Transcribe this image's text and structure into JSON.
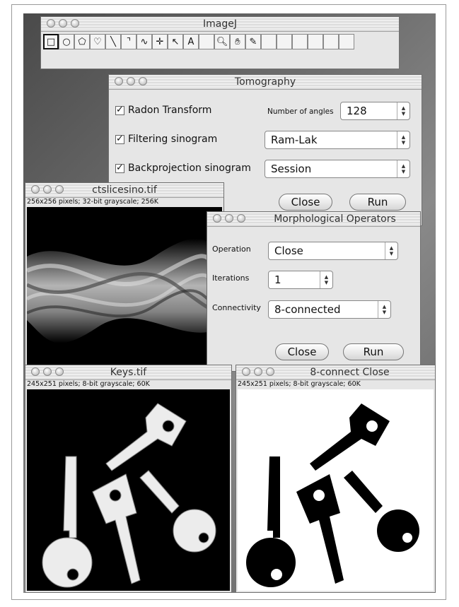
{
  "imagej": {
    "title": "ImageJ",
    "tools": [
      {
        "icon": "rectangle-tool-icon",
        "glyph": "□"
      },
      {
        "icon": "oval-tool-icon",
        "glyph": "○"
      },
      {
        "icon": "polygon-tool-icon",
        "glyph": "⬠"
      },
      {
        "icon": "freehand-tool-icon",
        "glyph": "♡"
      },
      {
        "icon": "straight-line-tool-icon",
        "glyph": "╲"
      },
      {
        "icon": "segmented-line-tool-icon",
        "glyph": "⌝"
      },
      {
        "icon": "freehand-line-tool-icon",
        "glyph": "∿"
      },
      {
        "icon": "crosshair-tool-icon",
        "glyph": "✛"
      },
      {
        "icon": "wand-tool-icon",
        "glyph": "↖"
      },
      {
        "icon": "text-tool-icon",
        "glyph": "A"
      },
      {
        "icon": "blank-tool-icon",
        "glyph": ""
      },
      {
        "icon": "magnifier-tool-icon",
        "glyph": "🔍︎"
      },
      {
        "icon": "hand-tool-icon",
        "glyph": "✋︎"
      },
      {
        "icon": "dropper-tool-icon",
        "glyph": "✎"
      },
      {
        "icon": "blank-tool-icon",
        "glyph": ""
      },
      {
        "icon": "blank-tool-icon",
        "glyph": ""
      },
      {
        "icon": "blank-tool-icon",
        "glyph": ""
      },
      {
        "icon": "blank-tool-icon",
        "glyph": ""
      },
      {
        "icon": "blank-tool-icon",
        "glyph": ""
      },
      {
        "icon": "blank-tool-icon",
        "glyph": ""
      }
    ]
  },
  "tomography": {
    "title": "Tomography",
    "radon_label": "Radon Transform",
    "radon_checked": "✓",
    "angles_label": "Number of angles",
    "angles_value": "128",
    "filtering_label": "Filtering sinogram",
    "filtering_checked": "✓",
    "filter_value": "Ram-Lak",
    "backprojection_label": "Backprojection sinogram",
    "backprojection_checked": "✓",
    "backprojection_value": "Session",
    "close_label": "Close",
    "run_label": "Run"
  },
  "sinogram": {
    "title": "ctslicesino.tif",
    "info": "256x256 pixels; 32-bit grayscale; 256K"
  },
  "morph": {
    "title": "Morphological Operators",
    "operation_label": "Operation",
    "operation_value": "Close",
    "iterations_label": "Iterations",
    "iterations_value": "1",
    "connectivity_label": "Connectivity",
    "connectivity_value": "8-connected",
    "close_label": "Close",
    "run_label": "Run"
  },
  "keys": {
    "title": "Keys.tif",
    "info": "245x251 pixels; 8-bit grayscale; 60K"
  },
  "closed": {
    "title": "8-connect Close",
    "info": "245x251 pixels; 8-bit grayscale; 60K"
  }
}
